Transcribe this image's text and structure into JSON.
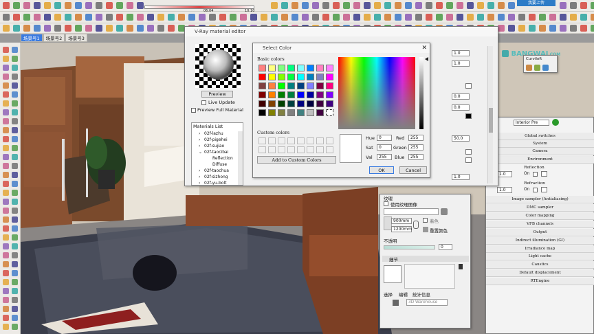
{
  "scene_tabs": [
    "场景号1",
    "场景号2",
    "场景号3"
  ],
  "timeline": {
    "time_left": "06:04",
    "ticks": [
      "1 2 3 4 5 6 7 8 9 10 11 12"
    ],
    "time_right": "10:10"
  },
  "watermark": {
    "logo_text": "BANGWAI",
    "suffix": ".COM",
    "upload_label": "我要上传"
  },
  "curviloft": {
    "title": "Curviloft"
  },
  "vray_editor": {
    "title": "V-Ray material editor",
    "preview_btn": "Preview",
    "live_update": "Live Update",
    "preview_full": "Preview Full Material",
    "materials_list_label": "Materials List",
    "materials": [
      {
        "name": "02f-lazhu",
        "indent": 1
      },
      {
        "name": "02f-pigehei",
        "indent": 1
      },
      {
        "name": "02f-sujiao",
        "indent": 1
      },
      {
        "name": "02f-taocibai",
        "indent": 1,
        "expanded": true
      },
      {
        "name": "Reflection",
        "indent": 2
      },
      {
        "name": "Diffuse",
        "indent": 2
      },
      {
        "name": "02f-taochua",
        "indent": 1
      },
      {
        "name": "02f-sizhong",
        "indent": 1
      },
      {
        "name": "02f-yu-bolt",
        "indent": 1
      }
    ],
    "right_values": [
      "1.0",
      "1.0",
      "0.0",
      "0.0",
      "50.0",
      "1.0"
    ]
  },
  "select_color": {
    "title": "Select Color",
    "basic_colors_label": "Basic colors",
    "custom_colors_label": "Custom colors",
    "add_custom_btn": "Add to Custom Colors",
    "hue_label": "Hue",
    "hue": "0",
    "sat_label": "Sat",
    "sat": "0",
    "val_label": "Val",
    "val": "255",
    "red_label": "Red",
    "red": "255",
    "green_label": "Green",
    "green": "255",
    "blue_label": "Blue",
    "blue": "255",
    "ok_btn": "OK",
    "cancel_btn": "Cancel",
    "basic_colors": [
      "#ff8080",
      "#ffff80",
      "#80ff80",
      "#00ff80",
      "#80ffff",
      "#0080ff",
      "#ff80c0",
      "#ff80ff",
      "#ff0000",
      "#ffff00",
      "#80ff00",
      "#00ff40",
      "#00ffff",
      "#0080c0",
      "#8080c0",
      "#ff00ff",
      "#804040",
      "#ff8040",
      "#00ff00",
      "#008080",
      "#004080",
      "#8080ff",
      "#800040",
      "#ff0080",
      "#800000",
      "#ff8000",
      "#008000",
      "#008040",
      "#0000ff",
      "#0000a0",
      "#800080",
      "#8000ff",
      "#400000",
      "#804000",
      "#004000",
      "#004040",
      "#000080",
      "#000040",
      "#400040",
      "#400080",
      "#000000",
      "#808000",
      "#808040",
      "#808080",
      "#408080",
      "#c0c0c0",
      "#400040",
      "#ffffff"
    ]
  },
  "vray_options": {
    "preset_label": "Interior Pre",
    "rollouts": [
      "Global switches",
      "System",
      "Camera",
      "Environment",
      "Image sampler (Antialiasing)",
      "DMC sampler",
      "Color mapping",
      "VFB channels",
      "Output",
      "Indirect illumination (GI)",
      "Irradiance map",
      "Light cache",
      "Caustics",
      "Default displacement",
      "RTEngine"
    ],
    "env_reflection": "Reflection",
    "env_refraction": "Refraction",
    "on_label": "On",
    "env_value": "1.0"
  },
  "materials_panel": {
    "texture_label": "纹理",
    "use_texture": "使用纹理图像",
    "width_value": "900mm",
    "height_value": "1200mm",
    "colorize": "着色",
    "reset_color": "重置颜色",
    "opacity_label": "不透明",
    "opacity_value": "0",
    "details_label": "细节",
    "tabs": [
      "选择",
      "编辑",
      "统计信息"
    ],
    "library_value": "3D Warehouse"
  }
}
